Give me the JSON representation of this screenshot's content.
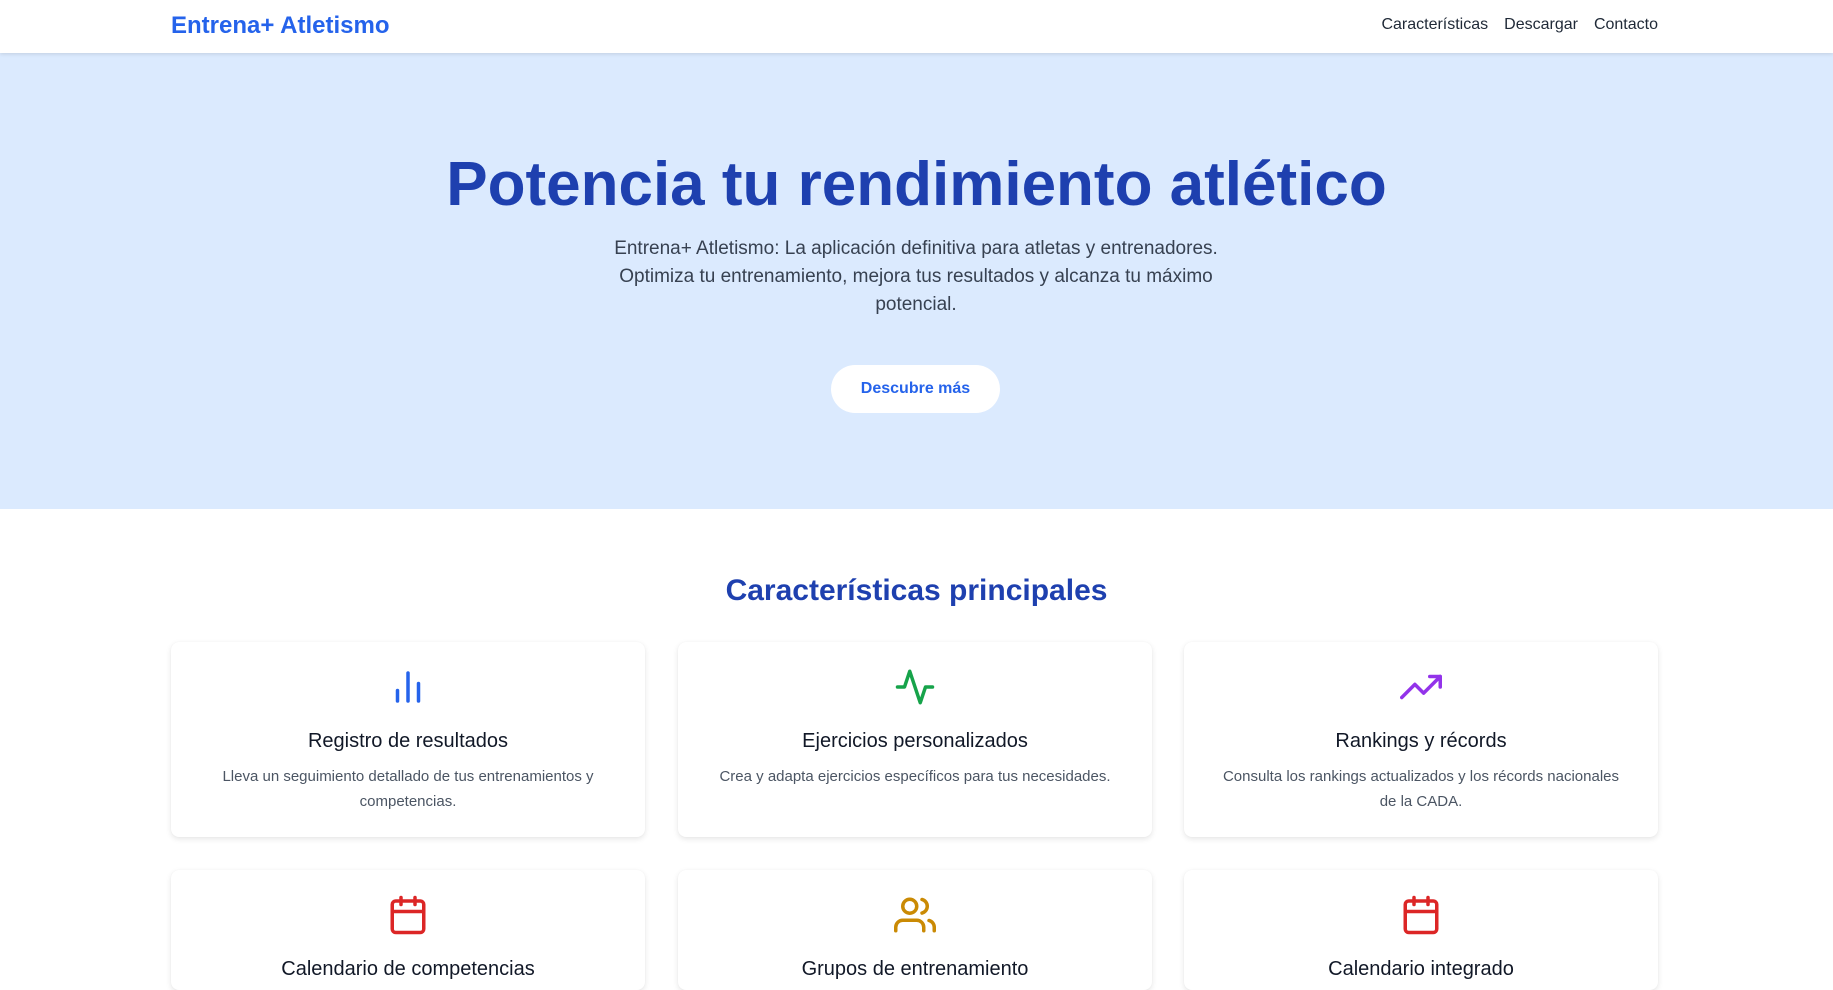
{
  "header": {
    "brand": "Entrena+ Atletismo",
    "nav": [
      "Características",
      "Descargar",
      "Contacto"
    ]
  },
  "hero": {
    "title": "Potencia tu rendimiento atlético",
    "subtitle": "Entrena+ Atletismo: La aplicación definitiva para atletas y entrenadores. Optimiza tu entrenamiento, mejora tus resultados y alcanza tu máximo potencial.",
    "cta": "Descubre más"
  },
  "features": {
    "title": "Características principales",
    "cards": [
      {
        "icon": "bar-chart-icon",
        "color": "#2563eb",
        "title": "Registro de resultados",
        "desc": "Lleva un seguimiento detallado de tus entrenamientos y competencias."
      },
      {
        "icon": "activity-icon",
        "color": "#16a34a",
        "title": "Ejercicios personalizados",
        "desc": "Crea y adapta ejercicios específicos para tus necesidades."
      },
      {
        "icon": "trending-up-icon",
        "color": "#9333ea",
        "title": "Rankings y récords",
        "desc": "Consulta los rankings actualizados y los récords nacionales de la CADA."
      },
      {
        "icon": "calendar-icon",
        "color": "#dc2626",
        "title": "Calendario de competencias",
        "desc": ""
      },
      {
        "icon": "users-icon",
        "color": "#ca8a04",
        "title": "Grupos de entrenamiento",
        "desc": ""
      },
      {
        "icon": "calendar-icon",
        "color": "#dc2626",
        "title": "Calendario integrado",
        "desc": ""
      }
    ]
  }
}
